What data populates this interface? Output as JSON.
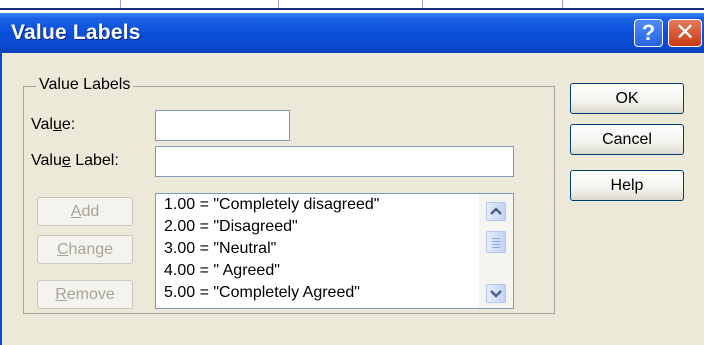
{
  "window": {
    "title": "Value Labels",
    "help_glyph": "?",
    "close_glyph": "✕"
  },
  "group": {
    "legend": "Value Labels"
  },
  "value_field": {
    "label_pre": "Val",
    "label_mnemonic": "u",
    "label_post": "e:",
    "value": ""
  },
  "value_label_field": {
    "label_pre": "Valu",
    "label_mnemonic": "e",
    "label_post": " Label:",
    "value": ""
  },
  "buttons": {
    "add": {
      "mnemonic": "A",
      "rest": "dd"
    },
    "change": {
      "mnemonic": "C",
      "rest": "hange"
    },
    "remove": {
      "mnemonic": "R",
      "rest": "emove"
    },
    "ok": "OK",
    "cancel": "Cancel",
    "help": "Help"
  },
  "labels_list": [
    "1.00 = \"Completely disagreed\"",
    "2.00 = \"Disagreed\"",
    "3.00 = \"Neutral\"",
    "4.00 = \" Agreed\"",
    "5.00 = \"Completely Agreed\""
  ],
  "icons": {
    "scroll_up": "chevron-up-icon",
    "scroll_down": "chevron-down-icon",
    "help": "question-icon",
    "close": "close-icon"
  },
  "colors": {
    "titlebar": "#0a4fd8",
    "dialog_bg": "#ece9d8",
    "close_button": "#c83a13"
  }
}
